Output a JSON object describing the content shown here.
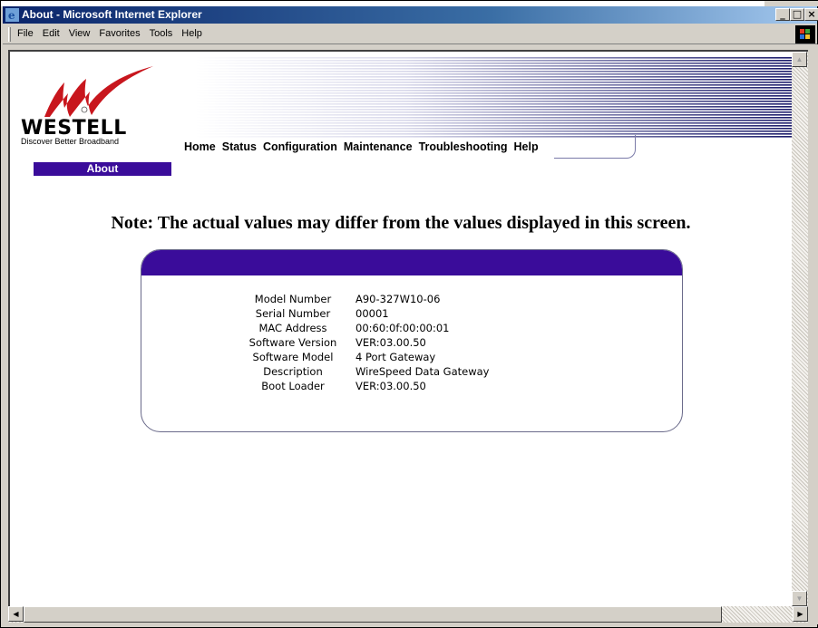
{
  "window": {
    "title": "About - Microsoft Internet Explorer",
    "buttons": {
      "minimize": "_",
      "maximize": "□",
      "close": "×"
    }
  },
  "menu": {
    "items": [
      "File",
      "Edit",
      "View",
      "Favorites",
      "Tools",
      "Help"
    ]
  },
  "brand": {
    "name": "WESTELL",
    "tagline": "Discover Better Broadband",
    "accent_color": "#3a0c9a",
    "logo_color": "#c8161d"
  },
  "nav": {
    "items": [
      "Home",
      "Status",
      "Configuration",
      "Maintenance",
      "Troubleshooting",
      "Help"
    ]
  },
  "page": {
    "section_label": "About",
    "note": "Note: The actual values may differ from the values displayed in this screen."
  },
  "about_info": [
    {
      "label": "Model Number",
      "value": "A90-327W10-06"
    },
    {
      "label": "Serial Number",
      "value": "00001"
    },
    {
      "label": "MAC Address",
      "value": "00:60:0f:00:00:01"
    },
    {
      "label": "Software Version",
      "value": "VER:03.00.50"
    },
    {
      "label": "Software Model",
      "value": "4 Port Gateway"
    },
    {
      "label": "Description",
      "value": "WireSpeed Data Gateway"
    },
    {
      "label": "Boot Loader",
      "value": "VER:03.00.50"
    }
  ],
  "icons": [
    "ie-icon",
    "windows-logo-icon",
    "scroll-up-icon",
    "scroll-down-icon",
    "scroll-left-icon",
    "scroll-right-icon"
  ]
}
